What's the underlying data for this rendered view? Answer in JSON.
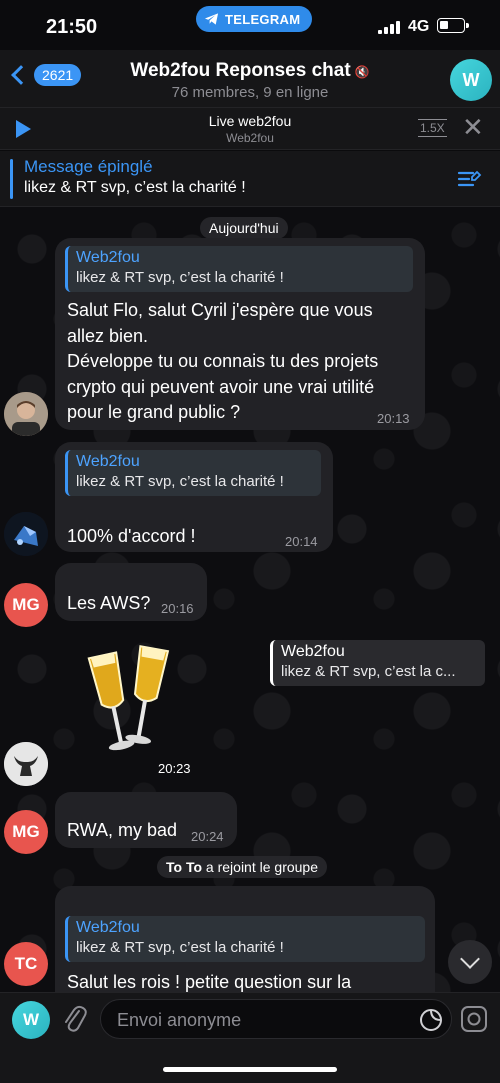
{
  "status_bar": {
    "time": "21:50",
    "telegram_label": "TELEGRAM",
    "network": "4G"
  },
  "header": {
    "back_count": "2621",
    "title": "Web2fou Reponses chat",
    "subtitle": "76 membres, 9 en ligne",
    "avatar_letter": "W"
  },
  "live": {
    "title": "Live web2fou",
    "subtitle": "Web2fou",
    "speed": "1.5X"
  },
  "pinned": {
    "title": "Message épinglé",
    "text": "likez & RT svp, c’est la charité !"
  },
  "date_separator": "Aujourd'hui",
  "messages": [
    {
      "reply_name": "Web2fou",
      "reply_text": "likez & RT svp, c’est la charité !",
      "lines": [
        "Salut Flo, salut Cyril j'espère que vous",
        "allez bien.",
        "Développe tu ou connais tu des projets",
        "crypto qui peuvent avoir une vrai utilité",
        "pour le grand public ?"
      ],
      "time": "20:13"
    },
    {
      "reply_name": "Web2fou",
      "reply_text": "likez & RT svp, c’est la charité !",
      "text": "100% d'accord !",
      "time": "20:14"
    },
    {
      "avatar": "MG",
      "text": "Les AWS?",
      "time": "20:16"
    },
    {
      "reply_name": "Web2fou",
      "reply_text": "likez & RT svp, c’est la c...",
      "time": "20:23"
    },
    {
      "avatar": "MG",
      "text": "RWA, my bad",
      "time": "20:24"
    },
    {
      "system_name": "To To",
      "system_text": " a rejoint le groupe"
    },
    {
      "avatar": "TC",
      "reply_name": "Web2fou",
      "reply_text": "likez & RT svp, c’est la charité !",
      "text": "Salut les rois ! petite question sur la"
    }
  ],
  "input": {
    "avatar_letter": "W",
    "placeholder": "Envoi anonyme"
  },
  "colors": {
    "accent": "#3b95f5",
    "bubble": "#222226",
    "avatar_mg": "#e8554e",
    "avatar_w": "#3cc7d0"
  }
}
